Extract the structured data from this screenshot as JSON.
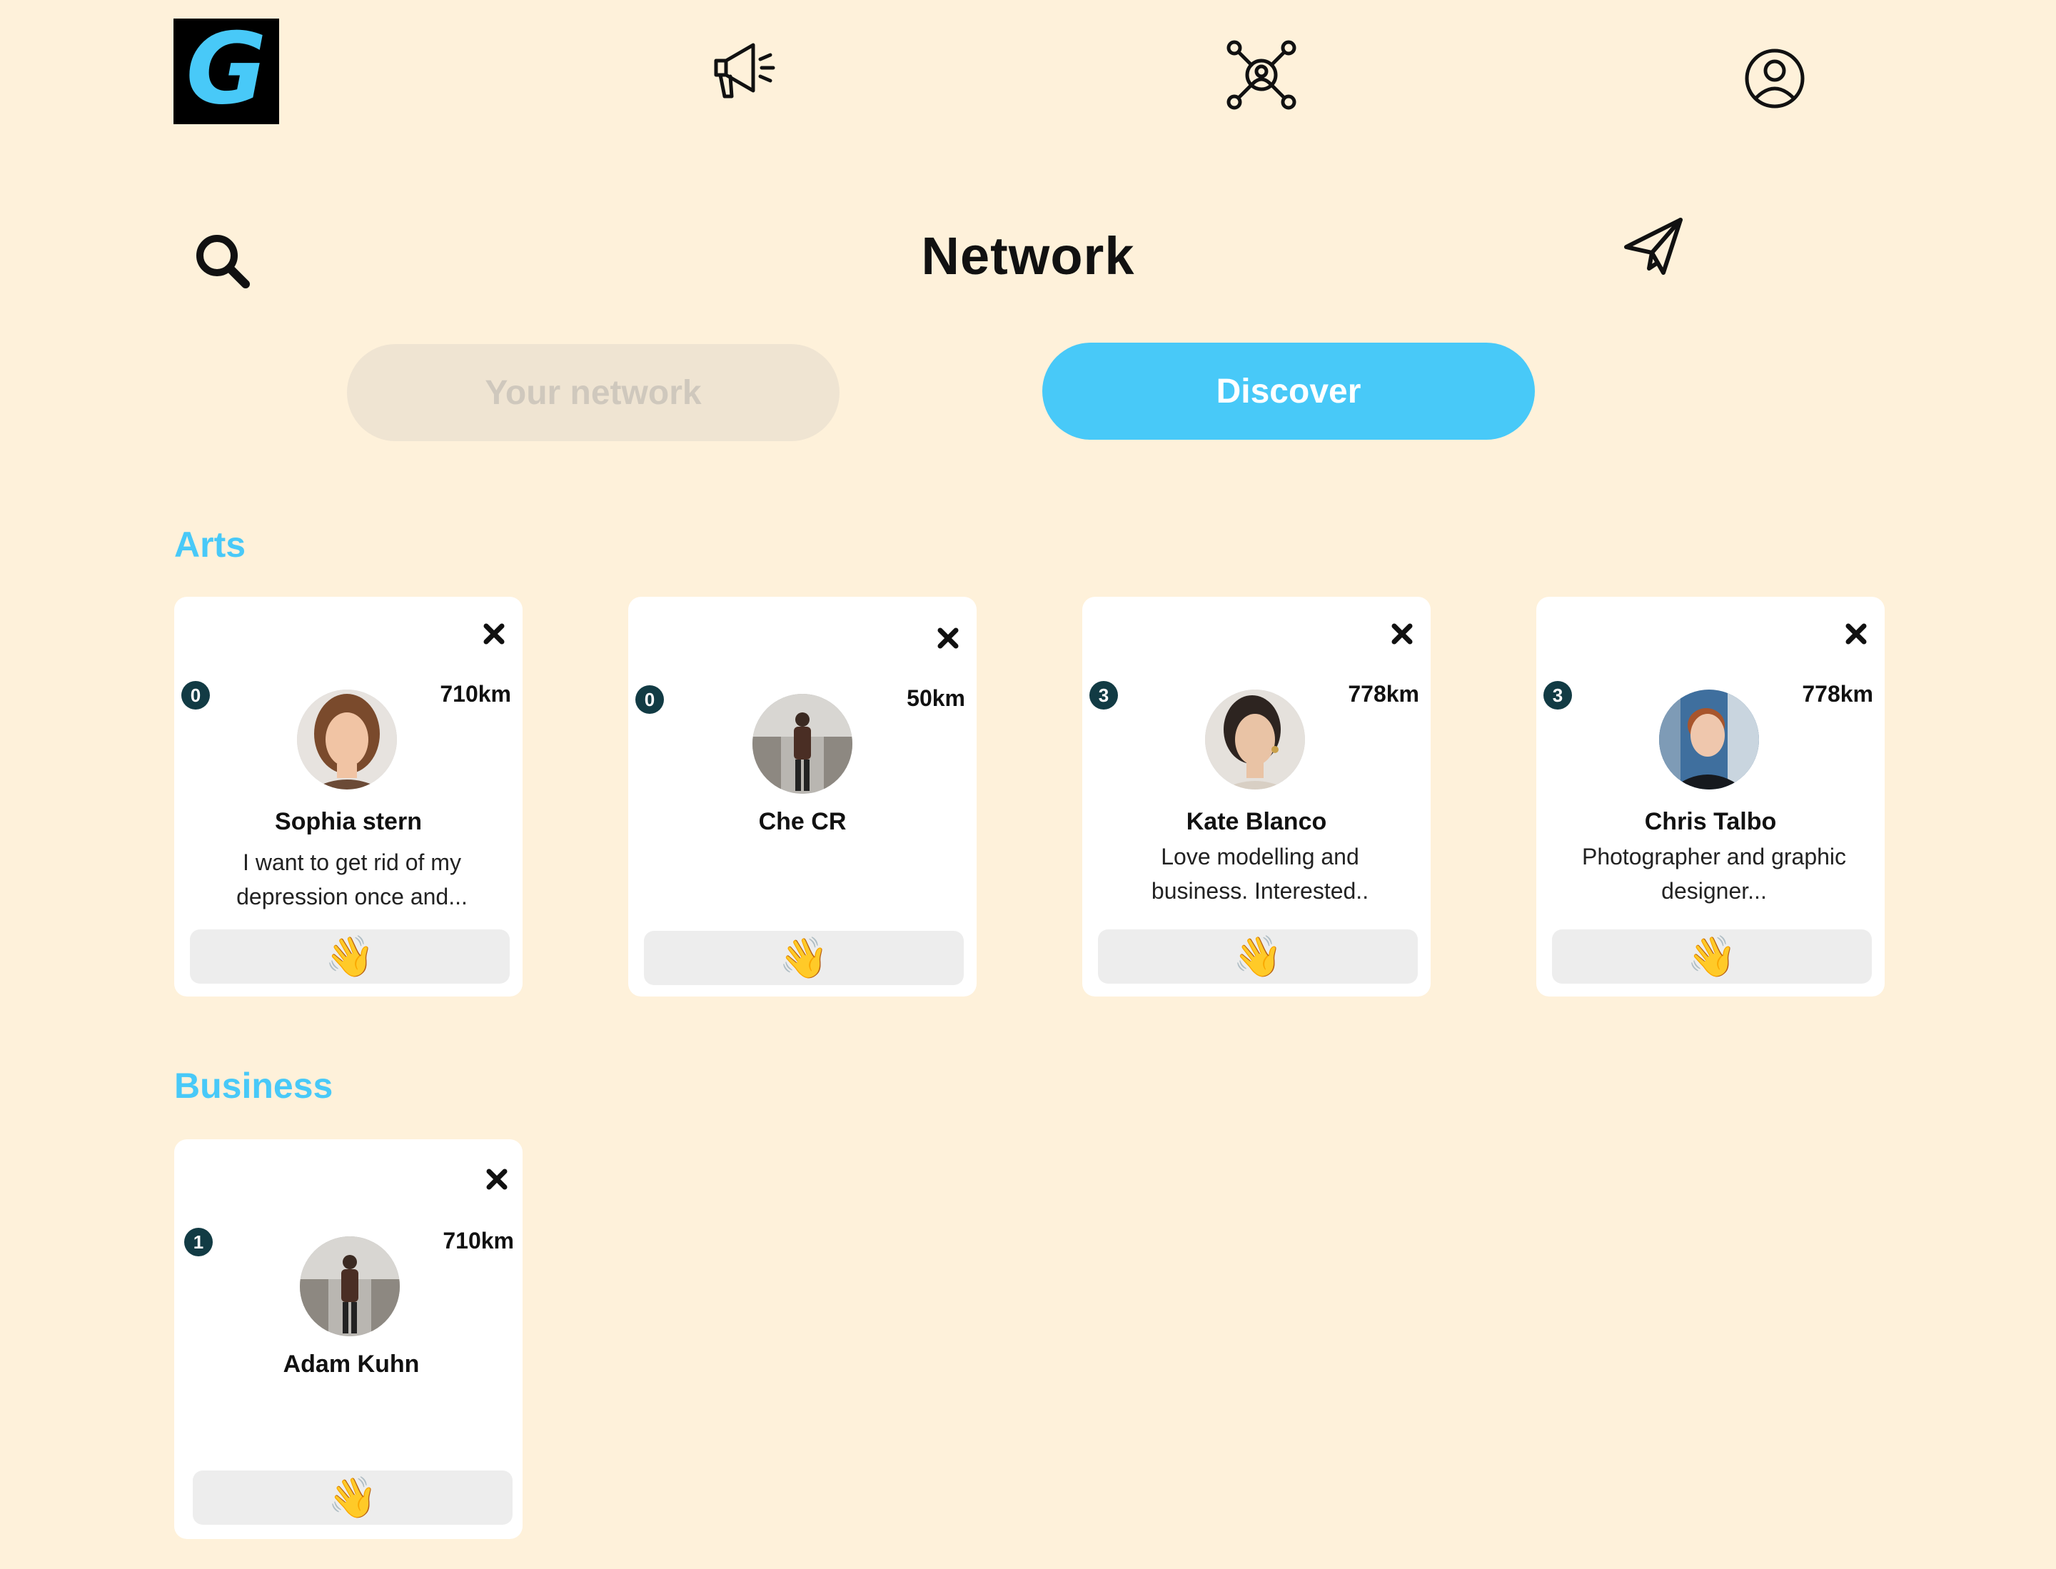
{
  "nav": {
    "logo_letter": "G",
    "items": [
      {
        "icon": "megaphone-icon"
      },
      {
        "icon": "network-hub-icon"
      },
      {
        "icon": "user-circle-icon"
      }
    ]
  },
  "header": {
    "title": "Network",
    "search_icon": "search-icon",
    "send_icon": "paper-plane-icon"
  },
  "tabs": {
    "your_network": "Your network",
    "discover": "Discover"
  },
  "colors": {
    "background": "#fef1da",
    "accent": "#48c9f8",
    "badge": "#123b44"
  },
  "sections": [
    {
      "title": "Arts",
      "cards": [
        {
          "badge": "0",
          "distance": "710km",
          "name": "Sophia stern",
          "bio": "I want to get rid of my depression once and...",
          "wave": "👋"
        },
        {
          "badge": "0",
          "distance": "50km",
          "name": "Che CR",
          "bio": "",
          "wave": "👋"
        },
        {
          "badge": "3",
          "distance": "778km",
          "name": "Kate Blanco",
          "bio": "Love modelling and business. Interested..",
          "wave": "👋"
        },
        {
          "badge": "3",
          "distance": "778km",
          "name": "Chris Talbo",
          "bio": "Photographer and graphic designer...",
          "wave": "👋"
        }
      ]
    },
    {
      "title": "Business",
      "cards": [
        {
          "badge": "1",
          "distance": "710km",
          "name": "Adam Kuhn",
          "bio": "",
          "wave": "👋"
        }
      ]
    }
  ]
}
